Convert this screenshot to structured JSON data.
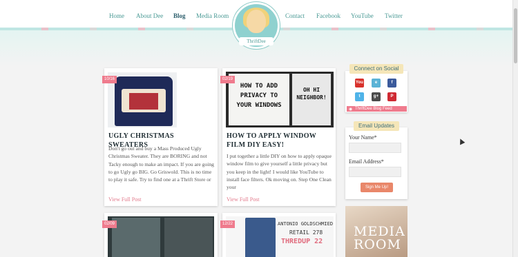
{
  "nav": {
    "items": [
      {
        "label": "Home",
        "active": false
      },
      {
        "label": "About Dee",
        "active": false
      },
      {
        "label": "Blog",
        "active": true
      },
      {
        "label": "Media Room",
        "active": false
      },
      {
        "label": "Contact",
        "active": false
      },
      {
        "label": "Facebook",
        "active": false
      },
      {
        "label": "YouTube",
        "active": false
      },
      {
        "label": "Twitter",
        "active": false
      }
    ],
    "logo_text": "ThriftDee"
  },
  "posts": [
    {
      "date": "10/16",
      "title": "UGLY CHRISTMAS SWEATERS",
      "excerpt": "Don't go out and buy a Mass Produced Ugly Christmas Sweater.  They are BORING and not Tacky enough to make an impact.  If you are going to go Ugly go BIG.  Go Griswold.  This is no time to play it safe. Try to find one at a Thrift Store or",
      "read_more": "View Full Post"
    },
    {
      "date": "02/19",
      "title": "HOW TO APPLY WINDOW FILM DIY EASY!",
      "excerpt": "I put together a little DIY on how to apply opaque window film to give yourself a little privacy but you keep in the light!  I would like YouTube to install face filters. Ok moving on.  Step One  Clean your",
      "read_more": "View Full Post",
      "image_text_left": "HOW TO ADD PRIVACY TO YOUR WINDOWS",
      "image_text_right": "OH HI NEIGHBOR!"
    },
    {
      "date": "02/09"
    },
    {
      "date": "12/22",
      "image_text_brand": "ANTONIO GOLDSCHMIED",
      "image_text_retail": "RETAIL 278",
      "image_text_thredup": "THREDUP 22"
    }
  ],
  "sidebar": {
    "social_header": "Connect on Social",
    "social_icons": [
      {
        "name": "youtube",
        "glyph": "You",
        "color": "#d8322c"
      },
      {
        "name": "ebay",
        "glyph": "e",
        "color": "#5bb3d6"
      },
      {
        "name": "facebook",
        "glyph": "f",
        "color": "#3b5a9b"
      },
      {
        "name": "twitter",
        "glyph": "t",
        "color": "#4fb3e8"
      },
      {
        "name": "google-plus",
        "glyph": "g+",
        "color": "#4b4b4b"
      },
      {
        "name": "pinterest",
        "glyph": "P",
        "color": "#cf2a33"
      }
    ],
    "feed_label": "ThriftDee Blog Feed",
    "email_header": "Email Updates",
    "name_label": "Your Name*",
    "email_label": "Email Address*",
    "signup_label": "Sign Me Up!",
    "media_text_1": "MEDIA",
    "media_text_2": "ROOM"
  }
}
